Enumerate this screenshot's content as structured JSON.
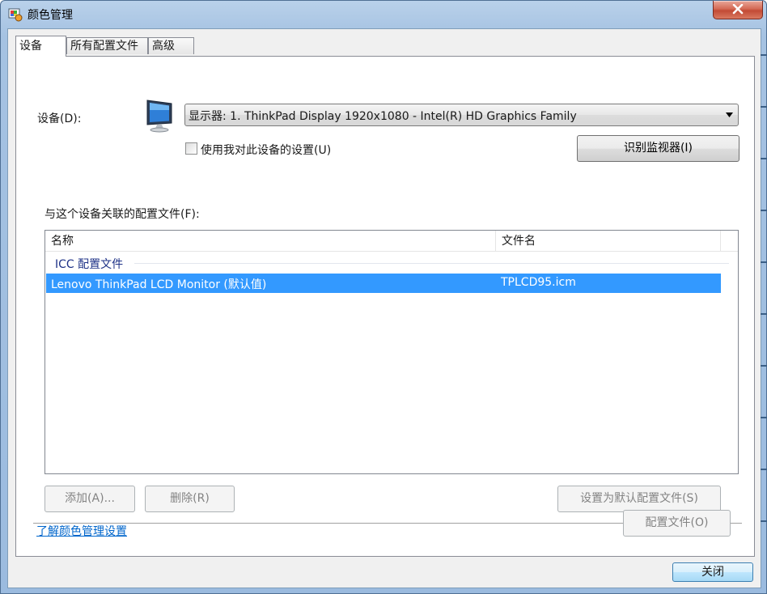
{
  "window": {
    "title": "颜色管理",
    "close_label": "关闭"
  },
  "tabs": [
    {
      "label": "设备"
    },
    {
      "label": "所有配置文件"
    },
    {
      "label": "高级"
    }
  ],
  "device": {
    "label": "设备(D):",
    "selected": "显示器: 1. ThinkPad Display 1920x1080 - Intel(R) HD Graphics Family",
    "use_settings_label": "使用我对此设备的设置(U)",
    "identify_button": "识别监视器(I)"
  },
  "profiles": {
    "label": "与这个设备关联的配置文件(F):",
    "columns": [
      "名称",
      "文件名"
    ],
    "group": "ICC 配置文件",
    "rows": [
      {
        "name": "Lenovo ThinkPad LCD Monitor (默认值)",
        "file": "TPLCD95.icm"
      }
    ]
  },
  "actions": {
    "add": "添加(A)...",
    "remove": "删除(R)",
    "set_default": "设置为默认配置文件(S)",
    "profile": "配置文件(O)"
  },
  "link": "了解颜色管理设置",
  "colors": {
    "selection": "#3399ff",
    "link": "#0066cc",
    "group_header": "#1e3287"
  }
}
